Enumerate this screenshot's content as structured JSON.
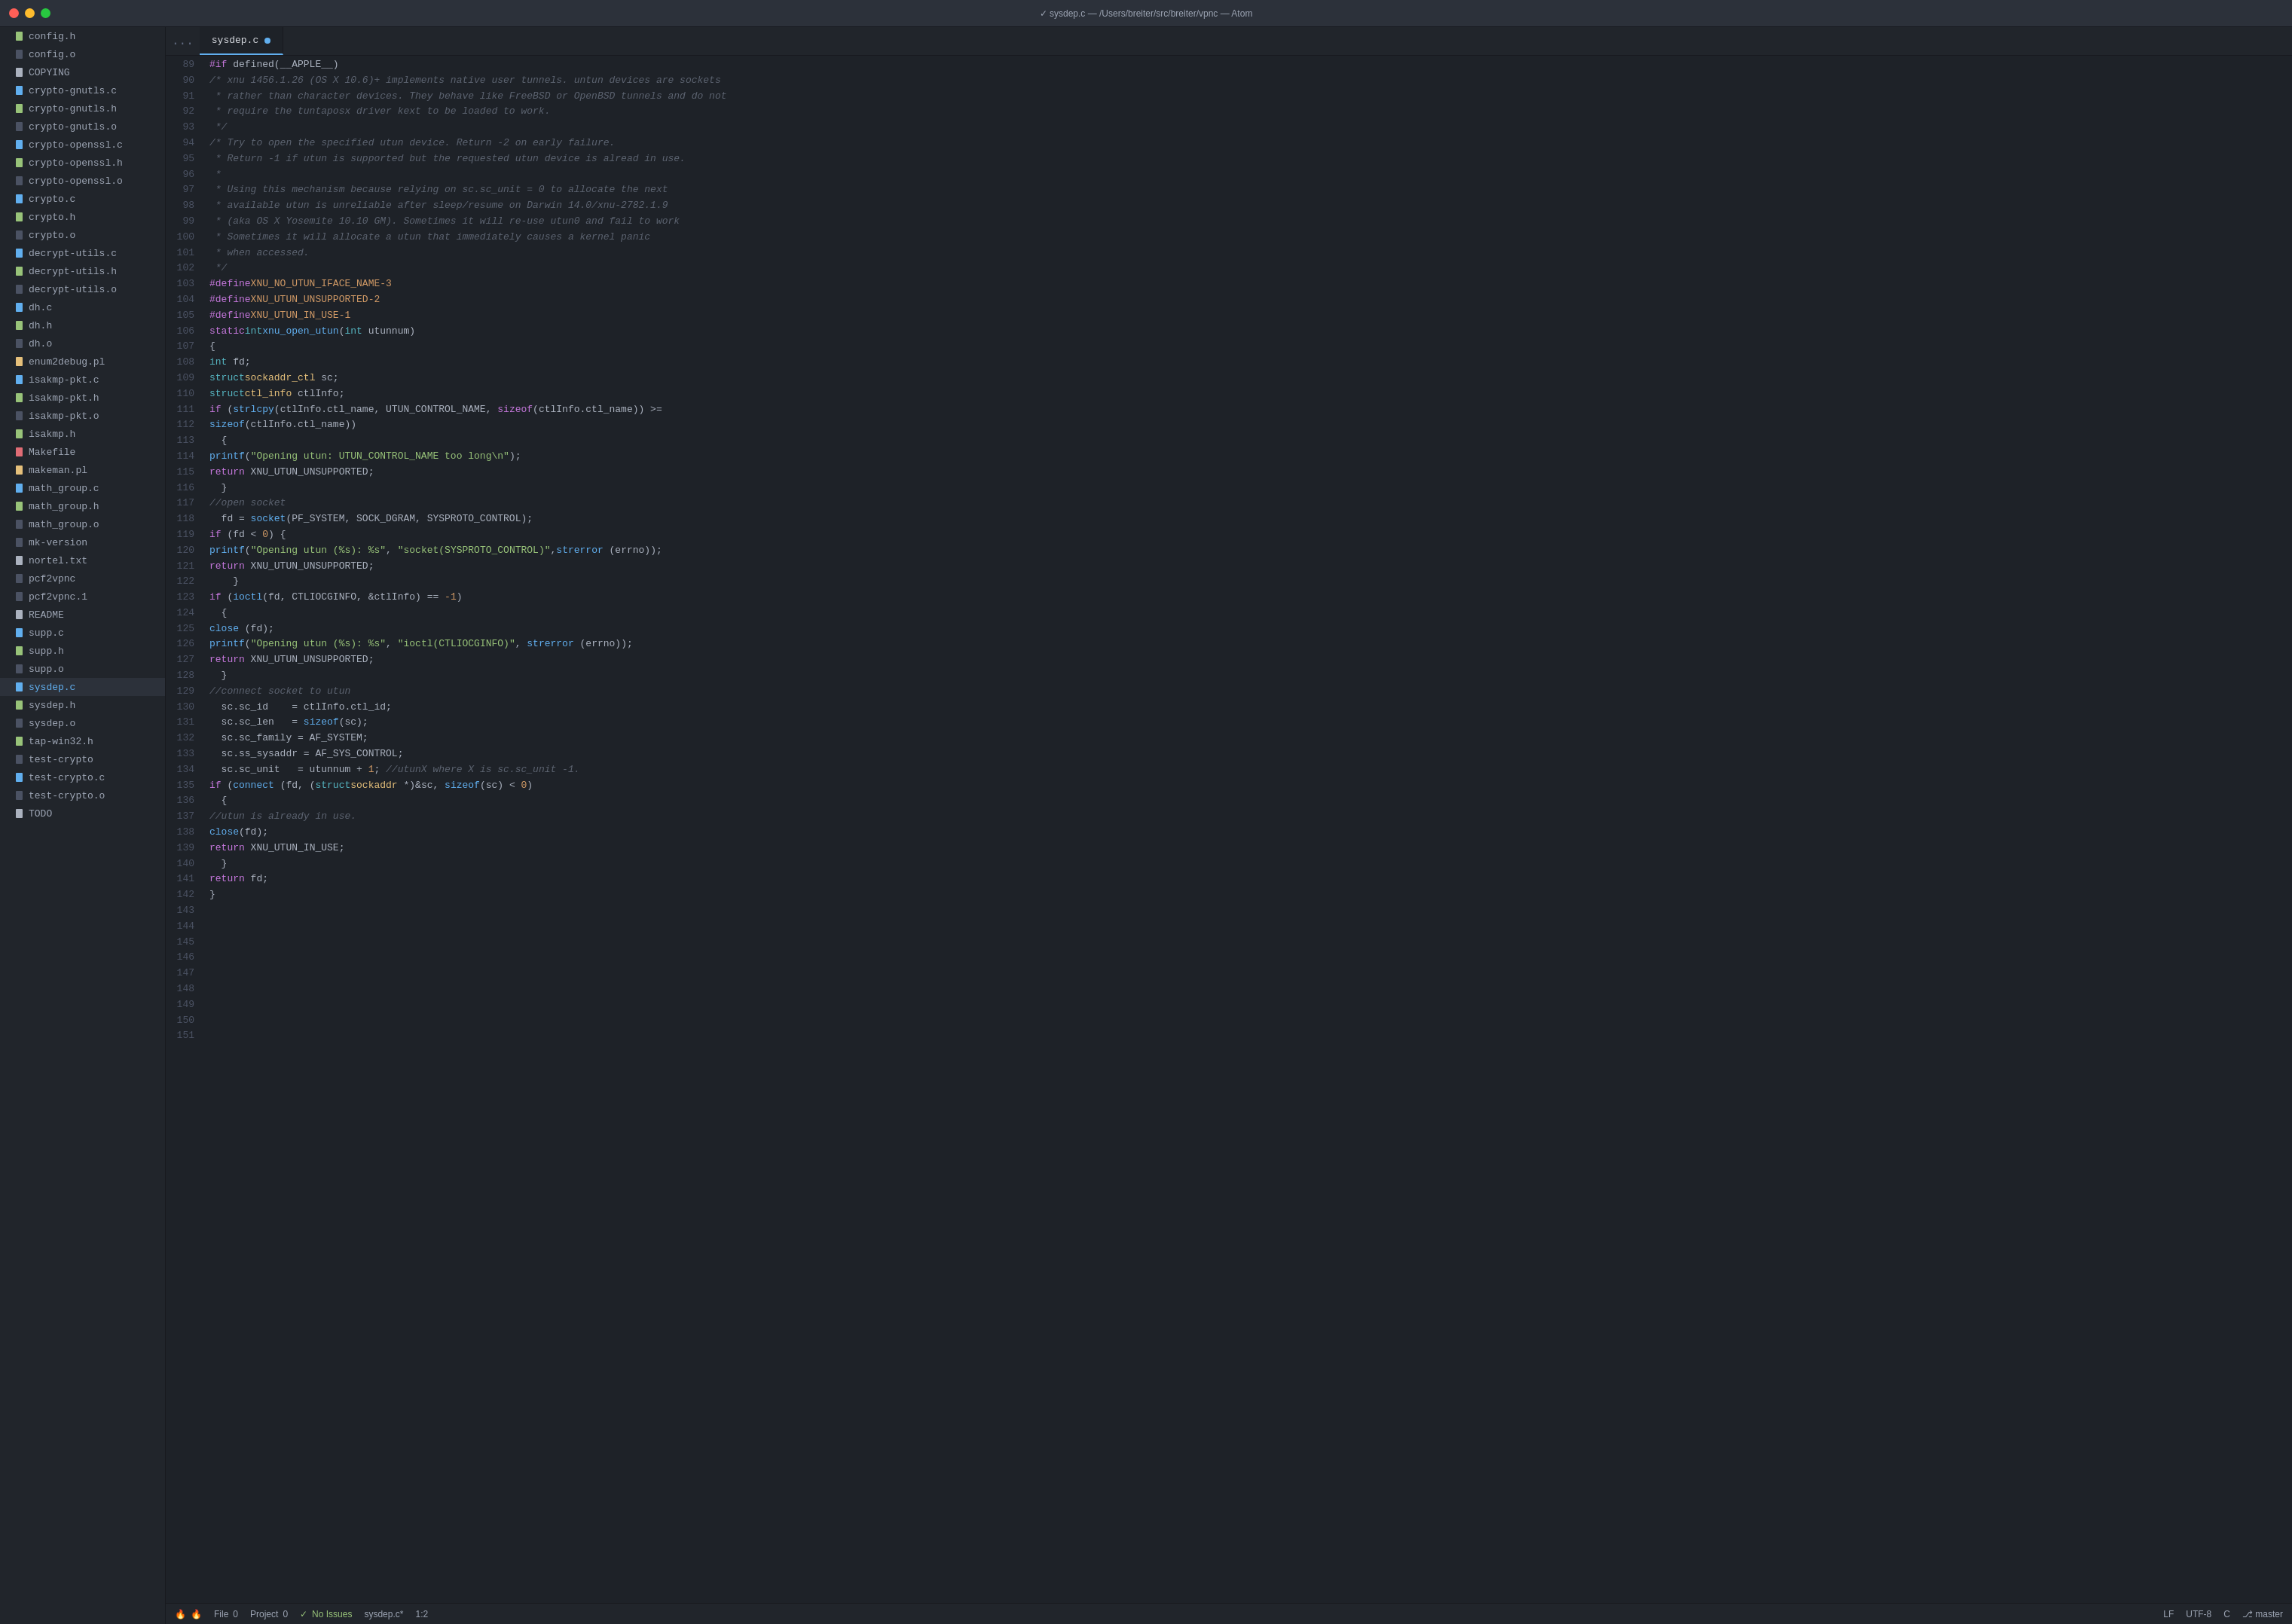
{
  "titleBar": {
    "title": "✓  sysdep.c — /Users/breiter/src/breiter/vpnc — Atom"
  },
  "sidebar": {
    "items": [
      {
        "name": "config.h",
        "icon": "📄",
        "type": "h"
      },
      {
        "name": "config.o",
        "icon": "📄",
        "type": "o"
      },
      {
        "name": "COPYING",
        "icon": "📄",
        "type": "txt"
      },
      {
        "name": "crypto-gnutls.c",
        "icon": "📄",
        "type": "c"
      },
      {
        "name": "crypto-gnutls.h",
        "icon": "📄",
        "type": "h"
      },
      {
        "name": "crypto-gnutls.o",
        "icon": "📄",
        "type": "o"
      },
      {
        "name": "crypto-openssl.c",
        "icon": "📄",
        "type": "c"
      },
      {
        "name": "crypto-openssl.h",
        "icon": "📄",
        "type": "h"
      },
      {
        "name": "crypto-openssl.o",
        "icon": "📄",
        "type": "o"
      },
      {
        "name": "crypto.c",
        "icon": "📄",
        "type": "c"
      },
      {
        "name": "crypto.h",
        "icon": "📄",
        "type": "h"
      },
      {
        "name": "crypto.o",
        "icon": "📄",
        "type": "o"
      },
      {
        "name": "decrypt-utils.c",
        "icon": "📄",
        "type": "c"
      },
      {
        "name": "decrypt-utils.h",
        "icon": "📄",
        "type": "h"
      },
      {
        "name": "decrypt-utils.o",
        "icon": "📄",
        "type": "o"
      },
      {
        "name": "dh.c",
        "icon": "📄",
        "type": "c"
      },
      {
        "name": "dh.h",
        "icon": "📄",
        "type": "h"
      },
      {
        "name": "dh.o",
        "icon": "📄",
        "type": "o"
      },
      {
        "name": "enum2debug.pl",
        "icon": "📄",
        "type": "pl"
      },
      {
        "name": "isakmp-pkt.c",
        "icon": "📄",
        "type": "c"
      },
      {
        "name": "isakmp-pkt.h",
        "icon": "📄",
        "type": "h"
      },
      {
        "name": "isakmp-pkt.o",
        "icon": "📄",
        "type": "o"
      },
      {
        "name": "isakmp.h",
        "icon": "📄",
        "type": "h"
      },
      {
        "name": "Makefile",
        "icon": "📄",
        "type": "mk"
      },
      {
        "name": "makeman.pl",
        "icon": "📄",
        "type": "pl"
      },
      {
        "name": "math_group.c",
        "icon": "📄",
        "type": "c"
      },
      {
        "name": "math_group.h",
        "icon": "📄",
        "type": "h"
      },
      {
        "name": "math_group.o",
        "icon": "📄",
        "type": "o"
      },
      {
        "name": "mk-version",
        "icon": "📄",
        "type": ""
      },
      {
        "name": "nortel.txt",
        "icon": "📄",
        "type": "txt"
      },
      {
        "name": "pcf2vpnc",
        "icon": "📄",
        "type": ""
      },
      {
        "name": "pcf2vpnc.1",
        "icon": "📄",
        "type": ""
      },
      {
        "name": "README",
        "icon": "📄",
        "type": "txt"
      },
      {
        "name": "supp.c",
        "icon": "📄",
        "type": "c"
      },
      {
        "name": "supp.h",
        "icon": "📄",
        "type": "h"
      },
      {
        "name": "supp.o",
        "icon": "📄",
        "type": "o"
      },
      {
        "name": "sysdep.c",
        "icon": "📄",
        "type": "c",
        "active": true
      },
      {
        "name": "sysdep.h",
        "icon": "📄",
        "type": "h"
      },
      {
        "name": "sysdep.o",
        "icon": "📄",
        "type": "o"
      },
      {
        "name": "tap-win32.h",
        "icon": "📄",
        "type": "h"
      },
      {
        "name": "test-crypto",
        "icon": "📄",
        "type": ""
      },
      {
        "name": "test-crypto.c",
        "icon": "📄",
        "type": "c"
      },
      {
        "name": "test-crypto.o",
        "icon": "📄",
        "type": "o"
      },
      {
        "name": "TODO",
        "icon": "📄",
        "type": "txt"
      }
    ]
  },
  "tabs": {
    "ellipsis": "...",
    "active": "sysdep.c",
    "modified": true
  },
  "statusBar": {
    "fileLabel": "File",
    "fileCount": "0",
    "projectLabel": "Project",
    "projectCount": "0",
    "noIssues": "No Issues",
    "filename": "sysdep.c*",
    "cursor": "1:2",
    "lineEnding": "LF",
    "encoding": "UTF-8",
    "language": "C",
    "gitBranch": "master"
  },
  "code": {
    "startLine": 89,
    "lines": [
      {
        "n": 89,
        "html": "<span class='kw'>#if</span> defined(__APPLE__)"
      },
      {
        "n": 90,
        "html": "<span class='cmt'>/* xnu 1456.1.26 (OS X 10.6)+ implements native user tunnels. untun devices are sockets</span>"
      },
      {
        "n": 91,
        "html": "<span class='cmt'> * rather than character devices. They behave like FreeBSD or OpenBSD tunnels and do not</span>"
      },
      {
        "n": 92,
        "html": "<span class='cmt'> * require the tuntaposx driver kext to be loaded to work.</span>"
      },
      {
        "n": 93,
        "html": "<span class='cmt'> */</span>"
      },
      {
        "n": 94,
        "html": ""
      },
      {
        "n": 95,
        "html": ""
      },
      {
        "n": 96,
        "html": "<span class='cmt'>/* Try to open the specified utun device. Return -2 on early failure.</span>"
      },
      {
        "n": 97,
        "html": "<span class='cmt'> * Return -1 if utun is supported but the requested utun device is alread in use.</span>"
      },
      {
        "n": 98,
        "html": "<span class='cmt'> *</span>"
      },
      {
        "n": 99,
        "html": "<span class='cmt'> * Using this mechanism because relying on sc.sc_unit = 0 to allocate the next</span>"
      },
      {
        "n": 100,
        "html": "<span class='cmt'> * available utun is unreliable after sleep/resume on Darwin 14.0/xnu-2782.1.9</span>"
      },
      {
        "n": 101,
        "html": "<span class='cmt'> * (aka OS X Yosemite 10.10 GM). Sometimes it will re-use utun0 and fail to work</span>"
      },
      {
        "n": 102,
        "html": "<span class='cmt'> * Sometimes it will allocate a utun that immediately causes a kernel panic</span>"
      },
      {
        "n": 103,
        "html": "<span class='cmt'> * when accessed.</span>"
      },
      {
        "n": 104,
        "html": "<span class='cmt'> */</span>"
      },
      {
        "n": 105,
        "html": ""
      },
      {
        "n": 106,
        "html": "<span class='pp'>#define</span> <span class='const-name'>XNU_NO_UTUN_IFACE_NAME</span> <span class='num'>-3</span>"
      },
      {
        "n": 107,
        "html": "<span class='pp'>#define</span> <span class='const-name'>XNU_UTUN_UNSUPPORTED</span> <span class='num'>-2</span>"
      },
      {
        "n": 108,
        "html": "<span class='pp'>#define</span> <span class='const-name'>XNU_UTUN_IN_USE</span> <span class='num'>-1</span>"
      },
      {
        "n": 109,
        "html": ""
      },
      {
        "n": 110,
        "html": "<span class='kw'>static</span> <span class='kw2'>int</span> <span class='fn'>xnu_open_utun</span>(<span class='kw2'>int</span> utunnum)"
      },
      {
        "n": 111,
        "html": "{"
      },
      {
        "n": 112,
        "html": "  <span class='kw2'>int</span> fd;"
      },
      {
        "n": 113,
        "html": "  <span class='kw2'>struct</span> <span class='type'>sockaddr_ctl</span> sc;"
      },
      {
        "n": 114,
        "html": "  <span class='kw2'>struct</span> <span class='type'>ctl_info</span> ctlInfo;"
      },
      {
        "n": 115,
        "html": ""
      },
      {
        "n": 116,
        "html": "  <span class='kw'>if</span> (<span class='fn'>strlcpy</span>(ctlInfo.ctl_name, UTUN_CONTROL_NAME, <span class='kw'>sizeof</span>(ctlInfo.ctl_name)) >="
      },
      {
        "n": 117,
        "html": "      <span class='fn'>sizeof</span>(ctlInfo.ctl_name))"
      },
      {
        "n": 118,
        "html": "  {"
      },
      {
        "n": 119,
        "html": "    <span class='fn'>printf</span>(<span class='str'>\"Opening utun: UTUN_CONTROL_NAME too long\\n\"</span>);"
      },
      {
        "n": 120,
        "html": "    <span class='kw'>return</span> XNU_UTUN_UNSUPPORTED;"
      },
      {
        "n": 121,
        "html": "  }"
      },
      {
        "n": 122,
        "html": ""
      },
      {
        "n": 123,
        "html": "  <span class='cmt'>//open socket</span>"
      },
      {
        "n": 124,
        "html": "  fd = <span class='fn'>socket</span>(PF_SYSTEM, SOCK_DGRAM, SYSPROTO_CONTROL);"
      },
      {
        "n": 125,
        "html": "  <span class='kw'>if</span> (fd &lt; <span class='num'>0</span>) {"
      },
      {
        "n": 126,
        "html": "    <span class='fn'>printf</span>(<span class='str'>\"Opening utun (%s): %s\"</span>, <span class='str'>\"socket(SYSPROTO_CONTROL)\"</span>,<span class='fn'>strerror</span> (errno));"
      },
      {
        "n": 127,
        "html": "    <span class='kw'>return</span> XNU_UTUN_UNSUPPORTED;"
      },
      {
        "n": 128,
        "html": "    }"
      },
      {
        "n": 129,
        "html": "  <span class='kw'>if</span> (<span class='fn'>ioctl</span>(fd, CTLIOCGINFO, &amp;ctlInfo) == <span class='num'>-1</span>)"
      },
      {
        "n": 130,
        "html": "  {"
      },
      {
        "n": 131,
        "html": "    <span class='fn'>close</span> (fd);"
      },
      {
        "n": 132,
        "html": "      <span class='fn'>printf</span>(<span class='str'>\"Opening utun (%s): %s\"</span>, <span class='str'>\"ioctl(CTLIOCGINFO)\"</span>, <span class='fn'>strerror</span> (errno));"
      },
      {
        "n": 133,
        "html": "    <span class='kw'>return</span> XNU_UTUN_UNSUPPORTED;"
      },
      {
        "n": 134,
        "html": "  }"
      },
      {
        "n": 135,
        "html": ""
      },
      {
        "n": 136,
        "html": "  <span class='cmt'>//connect socket to utun</span>"
      },
      {
        "n": 137,
        "html": "  sc.sc_id    = ctlInfo.ctl_id;"
      },
      {
        "n": 138,
        "html": "  sc.sc_len   = <span class='fn'>sizeof</span>(sc);"
      },
      {
        "n": 139,
        "html": "  sc.sc_family = AF_SYSTEM;"
      },
      {
        "n": 140,
        "html": "  sc.ss_sysaddr = AF_SYS_CONTROL;"
      },
      {
        "n": 141,
        "html": "  sc.sc_unit   = utunnum + <span class='num'>1</span>; <span class='cmt'>//utunX where X is sc.sc_unit -1.</span>"
      },
      {
        "n": 142,
        "html": ""
      },
      {
        "n": 143,
        "html": "  <span class='kw'>if</span> (<span class='fn'>connect</span> (fd, (<span class='kw2'>struct</span> <span class='type'>sockaddr</span> *)&amp;sc, <span class='fn'>sizeof</span>(sc) &lt; <span class='num'>0</span>)"
      },
      {
        "n": 144,
        "html": "  {"
      },
      {
        "n": 145,
        "html": "    <span class='cmt'>//utun is already in use.</span>"
      },
      {
        "n": 146,
        "html": "    <span class='fn'>close</span>(fd);"
      },
      {
        "n": 147,
        "html": "    <span class='kw'>return</span> XNU_UTUN_IN_USE;"
      },
      {
        "n": 148,
        "html": "  }"
      },
      {
        "n": 149,
        "html": ""
      },
      {
        "n": 150,
        "html": "  <span class='kw'>return</span> fd;"
      },
      {
        "n": 151,
        "html": "}"
      }
    ]
  }
}
